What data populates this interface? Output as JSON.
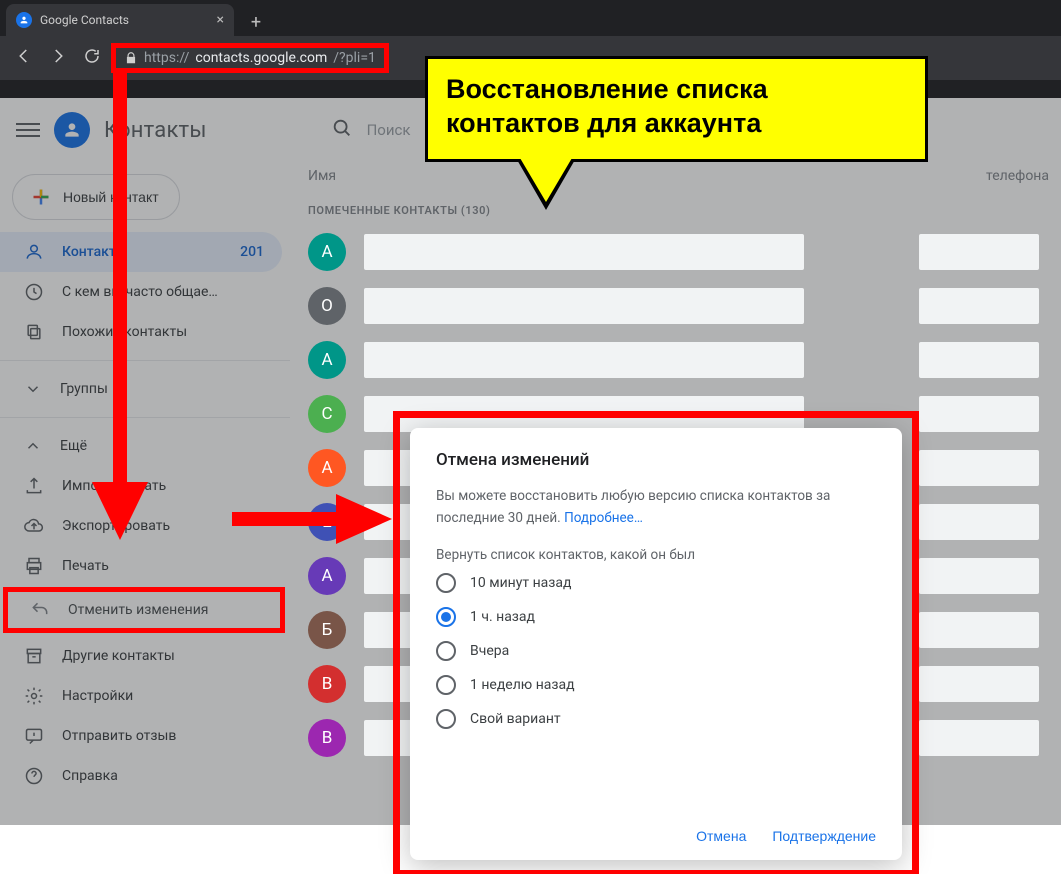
{
  "browser": {
    "tab_title": "Google Contacts",
    "url_scheme": "https://",
    "url_host": "contacts.google.com",
    "url_path": "/?pli=1"
  },
  "header": {
    "app_title": "Контакты",
    "search_placeholder": "Поиск"
  },
  "sidebar": {
    "new_contact": "Новый контакт",
    "contacts": {
      "label": "Контакты",
      "count": "201"
    },
    "frequent": "С кем вы часто общае…",
    "similar": "Похожие контакты",
    "groups": "Группы",
    "more": "Ещё",
    "import": "Импортировать",
    "export": "Экспортировать",
    "print": "Печать",
    "undo": "Отменить изменения",
    "other": "Другие контакты",
    "settings": "Настройки",
    "feedback": "Отправить отзыв",
    "help": "Справка"
  },
  "columns": {
    "name": "Имя",
    "phone": "телефона"
  },
  "section_label": "ПОМЕЧЕННЫЕ КОНТАКТЫ (130)",
  "rows": [
    {
      "letter": "А",
      "color": "#009688"
    },
    {
      "letter": "O",
      "color": "#5f6368"
    },
    {
      "letter": "А",
      "color": "#009688"
    },
    {
      "letter": "C",
      "color": "#4caf50"
    },
    {
      "letter": "A",
      "color": "#ff5722"
    },
    {
      "letter": "Е",
      "color": "#3f51b5"
    },
    {
      "letter": "А",
      "color": "#673ab7"
    },
    {
      "letter": "Б",
      "color": "#795548"
    },
    {
      "letter": "В",
      "color": "#d32f2f"
    },
    {
      "letter": "B",
      "color": "#9c27b0"
    }
  ],
  "dialog": {
    "title": "Отмена изменений",
    "desc_before": "Вы можете восстановить любую версию списка контактов за последние 30 дней. ",
    "desc_link": "Подробнее…",
    "subtitle": "Вернуть список контактов, какой он был",
    "options": [
      "10 минут назад",
      "1 ч. назад",
      "Вчера",
      "1 неделю назад",
      "Свой вариант"
    ],
    "selected_index": 1,
    "cancel": "Отмена",
    "confirm": "Подтверждение"
  },
  "callout": "Восстановление списка контактов для аккаунта"
}
